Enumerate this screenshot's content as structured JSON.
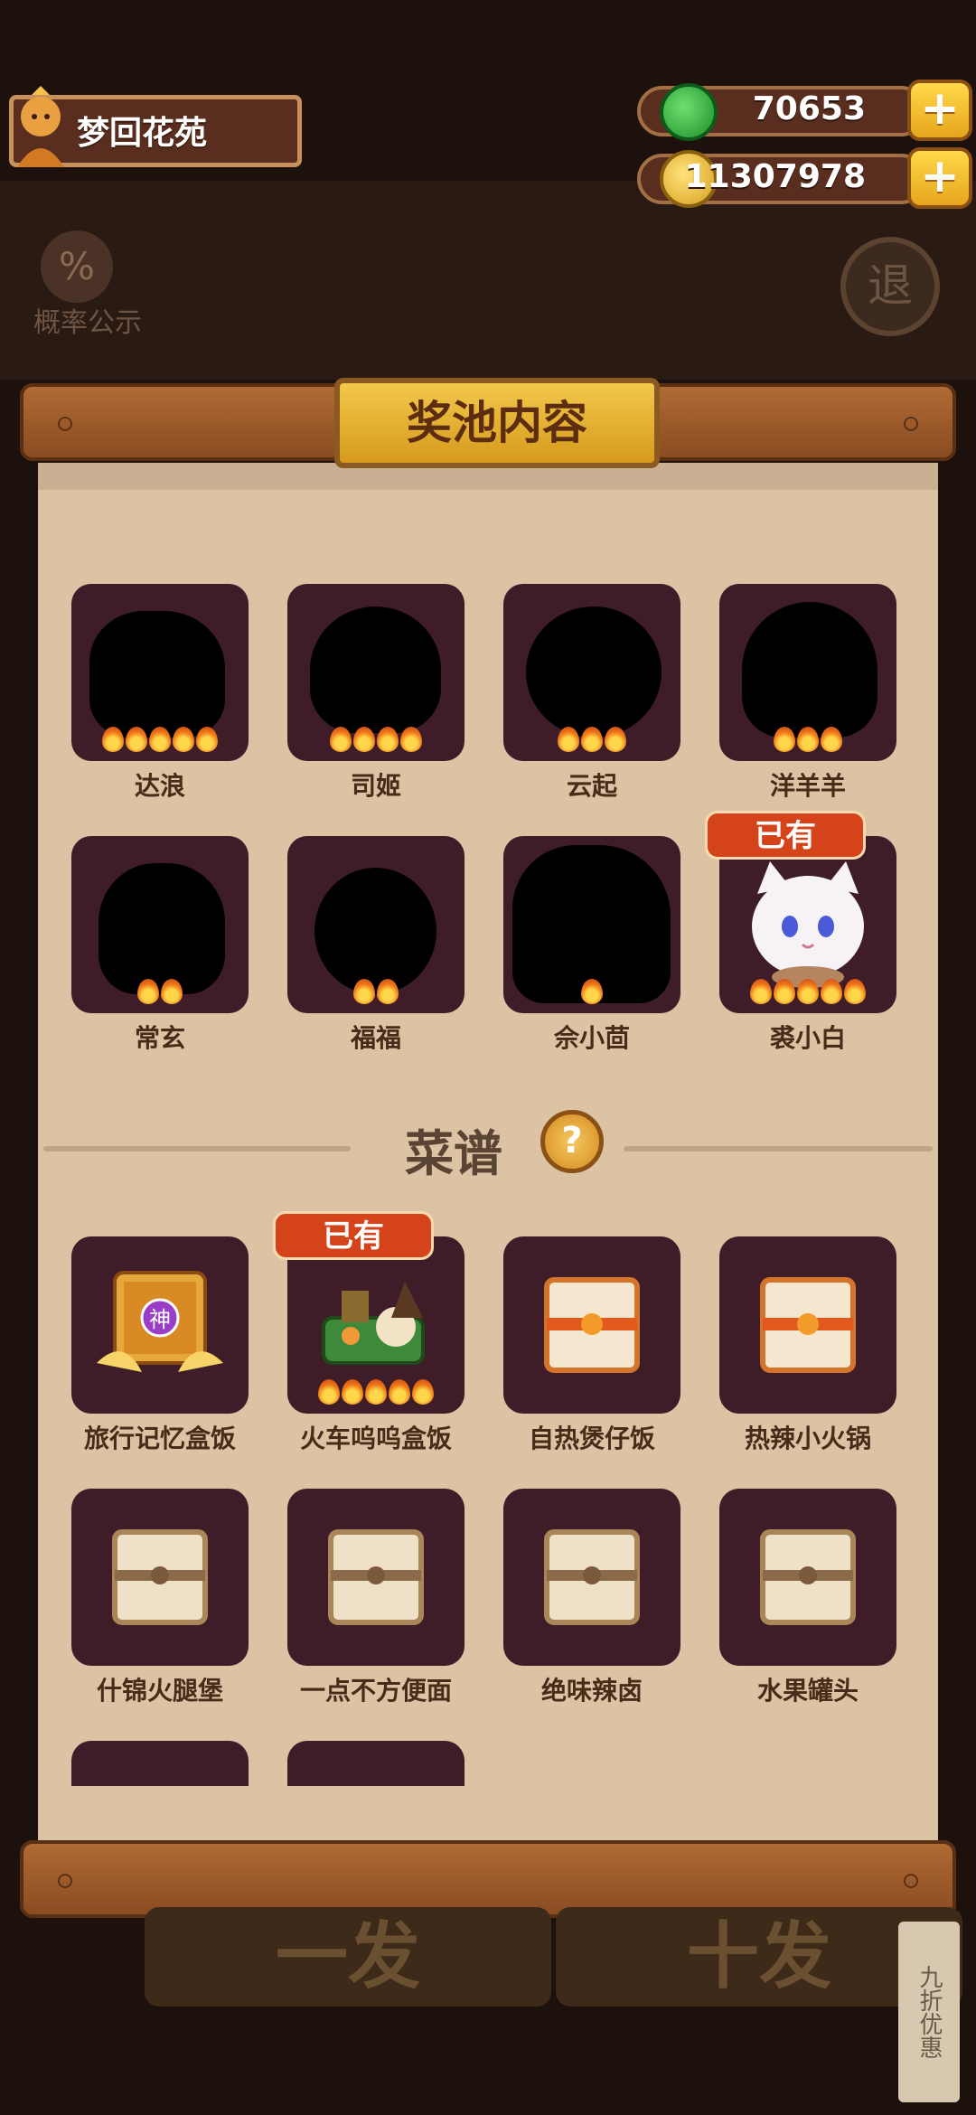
{
  "header": {
    "title": "梦回花苑",
    "jade_amount": "70653",
    "coin_amount": "11307978",
    "probability_label": "概率公示",
    "exit_label": "退"
  },
  "panel": {
    "title": "奖池内容",
    "owned_label": "已有",
    "characters": [
      {
        "name": "达浪",
        "stars": 5,
        "owned": false
      },
      {
        "name": "司姬",
        "stars": 4,
        "owned": false
      },
      {
        "name": "云起",
        "stars": 3,
        "owned": false
      },
      {
        "name": "洋羊羊",
        "stars": 3,
        "owned": false
      },
      {
        "name": "常玄",
        "stars": 2,
        "owned": false
      },
      {
        "name": "福福",
        "stars": 2,
        "owned": false
      },
      {
        "name": "佘小茴",
        "stars": 1,
        "owned": false
      },
      {
        "name": "裘小白",
        "stars": 5,
        "owned": true
      }
    ],
    "recipes_title": "菜谱",
    "recipes_help": "?",
    "recipes": [
      {
        "name": "旅行记忆盒饭",
        "owned": false,
        "god_tag": "神"
      },
      {
        "name": "火车呜呜盒饭",
        "owned": true
      },
      {
        "name": "自热煲仔饭",
        "owned": false
      },
      {
        "name": "热辣小火锅",
        "owned": false
      },
      {
        "name": "什锦火腿堡",
        "owned": false
      },
      {
        "name": "一点不方便面",
        "owned": false
      },
      {
        "name": "绝味辣卤",
        "owned": false
      },
      {
        "name": "水果罐头",
        "owned": false
      }
    ]
  },
  "bottom": {
    "single_draw": "一发",
    "ten_draw": "十发",
    "discount": "九折优惠"
  }
}
